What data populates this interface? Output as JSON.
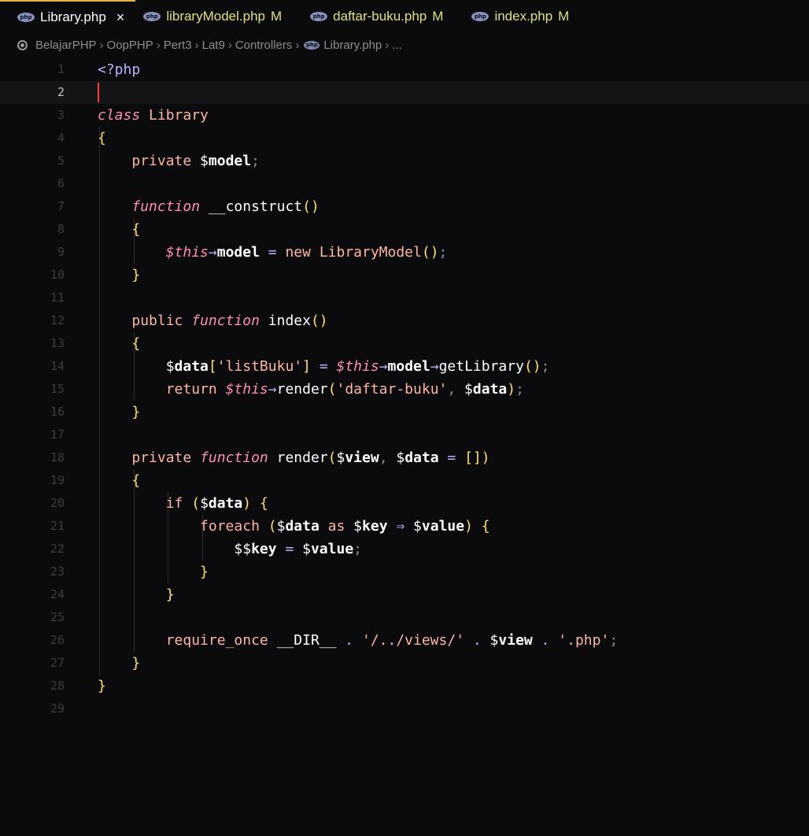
{
  "tabs": [
    {
      "name": "Library.php",
      "modified": "",
      "close": "×",
      "active": true
    },
    {
      "name": "libraryModel.php",
      "modified": "M",
      "close": "",
      "active": false
    },
    {
      "name": "daftar-buku.php",
      "modified": "M",
      "close": "",
      "active": false
    },
    {
      "name": "index.php",
      "modified": "M",
      "close": "",
      "active": false
    }
  ],
  "breadcrumb": [
    "BelajarPHP",
    "OopPHP",
    "Pert3",
    "Lat9",
    "Controllers",
    "Library.php",
    "..."
  ],
  "line_numbers": [
    "1",
    "2",
    "3",
    "4",
    "5",
    "6",
    "7",
    "8",
    "9",
    "10",
    "11",
    "12",
    "13",
    "14",
    "15",
    "16",
    "17",
    "18",
    "19",
    "20",
    "21",
    "22",
    "23",
    "24",
    "25",
    "26",
    "27",
    "28",
    "29"
  ],
  "current_line": 2,
  "code": [
    [
      [
        "op",
        "<?php"
      ]
    ],
    [],
    [
      [
        "kwi",
        "class"
      ],
      [
        "var",
        " "
      ],
      [
        "cls",
        "Library"
      ]
    ],
    [
      [
        "brace",
        "{"
      ]
    ],
    [
      [
        "var",
        "    "
      ],
      [
        "kw",
        "private"
      ],
      [
        "var",
        " $"
      ],
      [
        "prop",
        "model"
      ],
      [
        "punc",
        ";"
      ]
    ],
    [],
    [
      [
        "var",
        "    "
      ],
      [
        "kwi",
        "function"
      ],
      [
        "var",
        " "
      ],
      [
        "fn",
        "__construct"
      ],
      [
        "brace",
        "()"
      ]
    ],
    [
      [
        "var",
        "    "
      ],
      [
        "brace",
        "{"
      ]
    ],
    [
      [
        "var",
        "        "
      ],
      [
        "this",
        "$this"
      ],
      [
        "op",
        "→"
      ],
      [
        "prop",
        "model"
      ],
      [
        "var",
        " "
      ],
      [
        "op",
        "="
      ],
      [
        "var",
        " "
      ],
      [
        "kw",
        "new"
      ],
      [
        "var",
        " "
      ],
      [
        "cls",
        "LibraryModel"
      ],
      [
        "brace",
        "()"
      ],
      [
        "punc",
        ";"
      ]
    ],
    [
      [
        "var",
        "    "
      ],
      [
        "brace",
        "}"
      ]
    ],
    [],
    [
      [
        "var",
        "    "
      ],
      [
        "kw",
        "public"
      ],
      [
        "var",
        " "
      ],
      [
        "kwi",
        "function"
      ],
      [
        "var",
        " "
      ],
      [
        "fn",
        "index"
      ],
      [
        "brace",
        "()"
      ]
    ],
    [
      [
        "var",
        "    "
      ],
      [
        "brace",
        "{"
      ]
    ],
    [
      [
        "var",
        "        $"
      ],
      [
        "prop",
        "data"
      ],
      [
        "brace",
        "["
      ],
      [
        "str",
        "'listBuku'"
      ],
      [
        "brace",
        "]"
      ],
      [
        "var",
        " "
      ],
      [
        "op",
        "="
      ],
      [
        "var",
        " "
      ],
      [
        "this",
        "$this"
      ],
      [
        "op",
        "→"
      ],
      [
        "prop",
        "model"
      ],
      [
        "op",
        "→"
      ],
      [
        "fn",
        "getLibrary"
      ],
      [
        "brace",
        "()"
      ],
      [
        "punc",
        ";"
      ]
    ],
    [
      [
        "var",
        "        "
      ],
      [
        "kw",
        "return"
      ],
      [
        "var",
        " "
      ],
      [
        "this",
        "$this"
      ],
      [
        "op",
        "→"
      ],
      [
        "fn",
        "render"
      ],
      [
        "brace",
        "("
      ],
      [
        "str",
        "'daftar-buku'"
      ],
      [
        "punc",
        ","
      ],
      [
        "var",
        " $"
      ],
      [
        "prop",
        "data"
      ],
      [
        "brace",
        ")"
      ],
      [
        "punc",
        ";"
      ]
    ],
    [
      [
        "var",
        "    "
      ],
      [
        "brace",
        "}"
      ]
    ],
    [],
    [
      [
        "var",
        "    "
      ],
      [
        "kw",
        "private"
      ],
      [
        "var",
        " "
      ],
      [
        "kwi",
        "function"
      ],
      [
        "var",
        " "
      ],
      [
        "fn",
        "render"
      ],
      [
        "brace",
        "("
      ],
      [
        "var",
        "$"
      ],
      [
        "prop",
        "view"
      ],
      [
        "punc",
        ","
      ],
      [
        "var",
        " $"
      ],
      [
        "prop",
        "data"
      ],
      [
        "var",
        " "
      ],
      [
        "op",
        "="
      ],
      [
        "var",
        " "
      ],
      [
        "brace",
        "[])"
      ]
    ],
    [
      [
        "var",
        "    "
      ],
      [
        "brace",
        "{"
      ]
    ],
    [
      [
        "var",
        "        "
      ],
      [
        "kw",
        "if"
      ],
      [
        "var",
        " "
      ],
      [
        "brace",
        "("
      ],
      [
        "var",
        "$"
      ],
      [
        "prop",
        "data"
      ],
      [
        "brace",
        ")"
      ],
      [
        "var",
        " "
      ],
      [
        "brace",
        "{"
      ]
    ],
    [
      [
        "var",
        "            "
      ],
      [
        "kw",
        "foreach"
      ],
      [
        "var",
        " "
      ],
      [
        "brace",
        "("
      ],
      [
        "var",
        "$"
      ],
      [
        "prop",
        "data"
      ],
      [
        "var",
        " "
      ],
      [
        "kw",
        "as"
      ],
      [
        "var",
        " $"
      ],
      [
        "prop",
        "key"
      ],
      [
        "var",
        " "
      ],
      [
        "op",
        "⇒"
      ],
      [
        "var",
        " $"
      ],
      [
        "prop",
        "value"
      ],
      [
        "brace",
        ")"
      ],
      [
        "var",
        " "
      ],
      [
        "brace",
        "{"
      ]
    ],
    [
      [
        "var",
        "                $$"
      ],
      [
        "prop",
        "key"
      ],
      [
        "var",
        " "
      ],
      [
        "op",
        "="
      ],
      [
        "var",
        " $"
      ],
      [
        "prop",
        "value"
      ],
      [
        "punc",
        ";"
      ]
    ],
    [
      [
        "var",
        "            "
      ],
      [
        "brace",
        "}"
      ]
    ],
    [
      [
        "var",
        "        "
      ],
      [
        "brace",
        "}"
      ]
    ],
    [],
    [
      [
        "var",
        "        "
      ],
      [
        "kw",
        "require_once"
      ],
      [
        "var",
        " "
      ],
      [
        "const",
        "__DIR__"
      ],
      [
        "var",
        " "
      ],
      [
        "op",
        "."
      ],
      [
        "var",
        " "
      ],
      [
        "str",
        "'/../views/'"
      ],
      [
        "var",
        " "
      ],
      [
        "op",
        "."
      ],
      [
        "var",
        " $"
      ],
      [
        "prop",
        "view"
      ],
      [
        "var",
        " "
      ],
      [
        "op",
        "."
      ],
      [
        "var",
        " "
      ],
      [
        "str",
        "'.php'"
      ],
      [
        "punc",
        ";"
      ]
    ],
    [
      [
        "var",
        "    "
      ],
      [
        "brace",
        "}"
      ]
    ],
    [
      [
        "brace",
        "}"
      ]
    ],
    []
  ],
  "colors": {
    "background": "#0b0b0d",
    "active_tab_border": "#e8b24a",
    "modified": "#e3e084",
    "cursor": "#ff3b30"
  }
}
